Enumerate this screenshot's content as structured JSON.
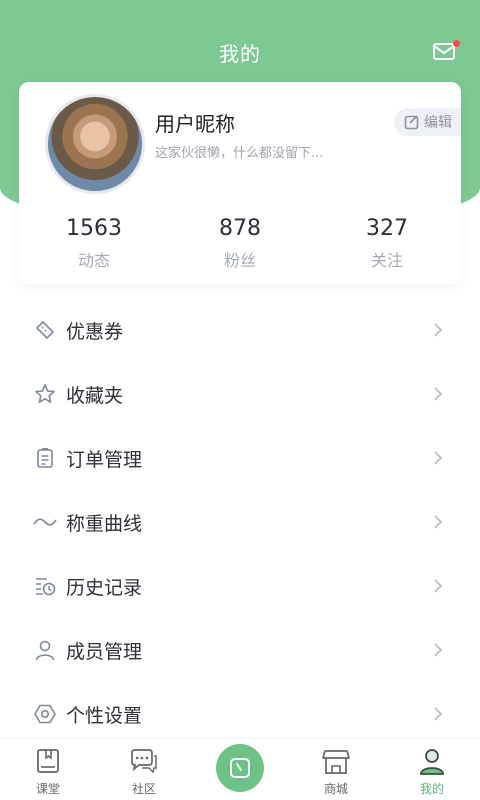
{
  "header": {
    "title": "我的"
  },
  "profile": {
    "nickname": "用户昵称",
    "bio": "这家伙很懒，什么都没留下...",
    "edit_label": "编辑"
  },
  "stats": [
    {
      "value": "1563",
      "label": "动态"
    },
    {
      "value": "878",
      "label": "粉丝"
    },
    {
      "value": "327",
      "label": "关注"
    }
  ],
  "menu": [
    {
      "label": "优惠券",
      "icon": "coupon-icon"
    },
    {
      "label": "收藏夹",
      "icon": "star-icon"
    },
    {
      "label": "订单管理",
      "icon": "clipboard-icon"
    },
    {
      "label": "称重曲线",
      "icon": "wave-icon"
    },
    {
      "label": "历史记录",
      "icon": "history-icon"
    },
    {
      "label": "成员管理",
      "icon": "person-icon"
    },
    {
      "label": "个性设置",
      "icon": "hexagon-settings-icon"
    }
  ],
  "tabbar": [
    {
      "label": "课堂",
      "icon": "book-icon"
    },
    {
      "label": "社区",
      "icon": "chat-bubbles-icon"
    },
    {
      "label": "",
      "icon": "scale-icon"
    },
    {
      "label": "商城",
      "icon": "store-icon"
    },
    {
      "label": "我的",
      "icon": "user-icon",
      "active": true
    }
  ],
  "colors": {
    "accent": "#7ec894",
    "active_tab": "#5cb37a",
    "notification_dot": "#ff4d4f"
  }
}
